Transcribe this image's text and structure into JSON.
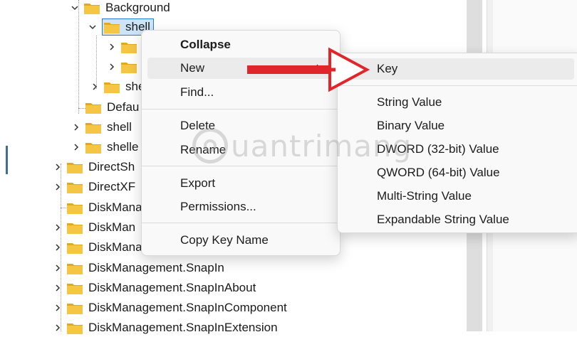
{
  "tree": {
    "rows": [
      {
        "label": "Background",
        "expanded": true
      },
      {
        "label": "shell",
        "expanded": true,
        "selected": true
      },
      {
        "label": "",
        "expanded": false
      },
      {
        "label": "",
        "expanded": false
      },
      {
        "label": "she",
        "expanded": false
      },
      {
        "label": "Defau",
        "expanded": null
      },
      {
        "label": "shell",
        "expanded": false
      },
      {
        "label": "shelle",
        "expanded": false
      },
      {
        "label": "DirectSh",
        "expanded": false
      },
      {
        "label": "DirectXF",
        "expanded": false
      },
      {
        "label": "DiskMana",
        "expanded": null
      },
      {
        "label": "DiskMan",
        "expanded": false
      },
      {
        "label": "DiskManag",
        "expanded": false
      },
      {
        "label": "DiskManagement.SnapIn",
        "expanded": false
      },
      {
        "label": "DiskManagement.SnapInAbout",
        "expanded": false
      },
      {
        "label": "DiskManagement.SnapInComponent",
        "expanded": false
      },
      {
        "label": "DiskManagement.SnapInExtension",
        "expanded": false
      }
    ]
  },
  "context_menu": {
    "items": [
      {
        "label": "Collapse",
        "bold": true
      },
      {
        "label": "New",
        "has_submenu": true,
        "hot": true
      },
      {
        "label": "Find..."
      },
      {
        "label": "Delete"
      },
      {
        "label": "Rename"
      },
      {
        "label": "Export"
      },
      {
        "label": "Permissions..."
      },
      {
        "label": "Copy Key Name"
      }
    ]
  },
  "submenu": {
    "items": [
      {
        "label": "Key"
      },
      {
        "label": "String Value"
      },
      {
        "label": "Binary Value"
      },
      {
        "label": "DWORD (32-bit) Value"
      },
      {
        "label": "QWORD (64-bit) Value"
      },
      {
        "label": "Multi-String Value"
      },
      {
        "label": "Expandable String Value"
      }
    ]
  },
  "watermark": {
    "text": "uantrimang"
  },
  "colors": {
    "folder": "#f5c544",
    "folder_dark": "#e0a91f",
    "selection": "#cce4f7",
    "arrow": "#e0262b"
  }
}
